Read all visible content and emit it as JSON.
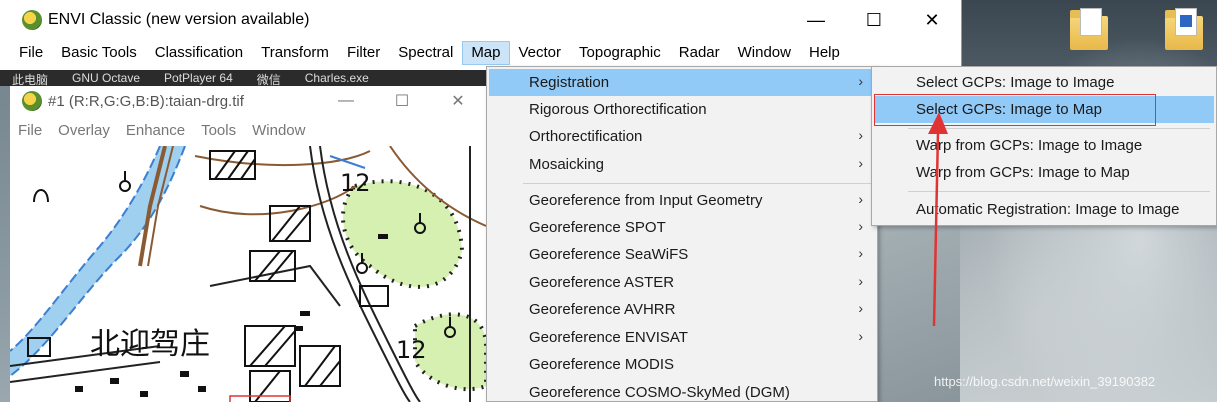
{
  "app_window": {
    "title": "ENVI Classic (new version available)",
    "controls": {
      "minimize": "—",
      "maximize": "☐",
      "close": "✕"
    },
    "menu": [
      "File",
      "Basic Tools",
      "Classification",
      "Transform",
      "Filter",
      "Spectral",
      "Map",
      "Vector",
      "Topographic",
      "Radar",
      "Window",
      "Help"
    ],
    "active_menu": "Map"
  },
  "taskbar_strip": [
    "此电脑",
    "GNU Octave",
    "PotPlayer 64",
    "微信",
    "Charles.exe"
  ],
  "image_window": {
    "title": "#1 (R:R,G:G,B:B):taian-drg.tif",
    "controls": {
      "minimize": "—",
      "maximize": "☐",
      "close": "✕"
    },
    "menu": [
      "File",
      "Overlay",
      "Enhance",
      "Tools",
      "Window"
    ],
    "map_labels": [
      "北迎驾庄",
      "12",
      "12"
    ]
  },
  "map_menu": {
    "items": [
      {
        "label": "Registration",
        "submenu": true
      },
      {
        "label": "Rigorous Orthorectification",
        "submenu": false
      },
      {
        "label": "Orthorectification",
        "submenu": true
      },
      {
        "label": "Mosaicking",
        "submenu": true
      },
      {
        "label": "Georeference from Input Geometry",
        "submenu": true
      },
      {
        "label": "Georeference SPOT",
        "submenu": true
      },
      {
        "label": "Georeference SeaWiFS",
        "submenu": true
      },
      {
        "label": "Georeference ASTER",
        "submenu": true
      },
      {
        "label": "Georeference AVHRR",
        "submenu": true
      },
      {
        "label": "Georeference ENVISAT",
        "submenu": true
      },
      {
        "label": "Georeference MODIS",
        "submenu": false
      },
      {
        "label": "Georeference COSMO-SkyMed (DGM)",
        "submenu": false
      }
    ]
  },
  "registration_submenu": {
    "items": [
      "Select GCPs: Image to Image",
      "Select GCPs: Image to Map",
      "Warp from GCPs: Image to Image",
      "Warp from GCPs: Image to Map",
      "Automatic Registration: Image to Image"
    ],
    "highlighted": "Select GCPs: Image to Map"
  },
  "arrow_glyph": "›",
  "colors": {
    "menu_highlight": "#91c9f7",
    "annotation_red": "#e03434",
    "map_green": "#d5f0b0",
    "map_water": "#9fd0f0"
  },
  "watermark": "https://blog.csdn.net/weixin_39190382"
}
